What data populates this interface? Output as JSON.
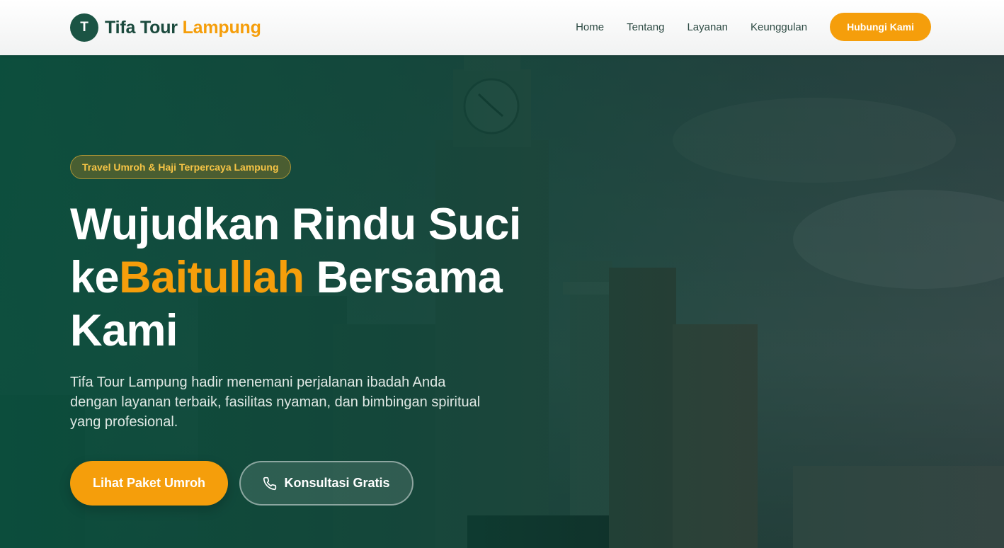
{
  "brand": {
    "mark": "T",
    "name": "Tifa Tour",
    "accent": "Lampung"
  },
  "nav": {
    "items": [
      {
        "label": "Home"
      },
      {
        "label": "Tentang"
      },
      {
        "label": "Layanan"
      },
      {
        "label": "Keunggulan"
      }
    ],
    "cta": "Hubungi Kami"
  },
  "hero": {
    "badge": "Travel Umroh & Haji Terpercaya Lampung",
    "headline": {
      "line1": "Wujudkan Rindu Suci",
      "pre": "ke",
      "highlight": "Baitullah",
      "post": " Bersama Kami"
    },
    "lead": "Tifa Tour Lampung hadir menemani perjalanan ibadah Anda dengan layanan terbaik, fasilitas nyaman, dan bimbingan spiritual yang profesional.",
    "primary_button": "Lihat Paket Umroh",
    "secondary_button": "Konsultasi Gratis",
    "secondary_icon": "phone-icon"
  },
  "colors": {
    "accent": "#f59e0b",
    "brand_green": "#1b5444"
  }
}
